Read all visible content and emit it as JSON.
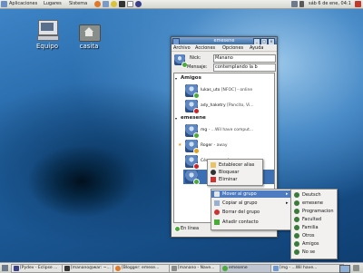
{
  "top_panel": {
    "menus": [
      "Aplicaciones",
      "Lugares",
      "Sistema"
    ],
    "clock": "sáb 6 de ene, 04:1"
  },
  "desktop": {
    "icons": [
      {
        "label": "Equipo",
        "icon": "computer-icon"
      },
      {
        "label": "casita",
        "icon": "home-folder-icon"
      }
    ]
  },
  "window": {
    "title": "emesene",
    "menu": [
      "Archivo",
      "Acciones",
      "Opciones",
      "Ayuda"
    ],
    "nick_label": "Nick:",
    "nick_value": "Manano",
    "message_label": "Mensaje:",
    "message_value": "contemplando la b",
    "groups": [
      {
        "name": "Amigos",
        "contacts": [
          {
            "name": "lukas_uto",
            "status": "[NFOC] - online",
            "dot": "#4caa3a"
          },
          {
            "name": "ady_haketry",
            "status": "[Pancito, Vi...",
            "dot": "#cc2222"
          }
        ]
      },
      {
        "name": "emesene",
        "contacts": [
          {
            "name": "mg",
            "status": "- ...Wil have comput...",
            "dot": "#4caa3a"
          },
          {
            "name": "Roger",
            "status": "- away",
            "dot": "#e0a020"
          },
          {
            "name": "César",
            "status": "- www.forumz.co...",
            "dot": "#cc2222"
          },
          {
            "name": "",
            "status": "",
            "dot": "#4caa3a"
          }
        ]
      }
    ],
    "bottom_label": "En línea"
  },
  "context_menu": {
    "items": [
      "Establecer alias",
      "Bloquear",
      "Eliminar"
    ]
  },
  "group_menu": {
    "items": [
      "Mover al grupo",
      "Copiar al grupo",
      "Borrar del grupo",
      "Añadir contacto"
    ]
  },
  "submenu": {
    "items": [
      "Deutsch",
      "emesene",
      "Programacion",
      "Facultad",
      "Familia",
      "Otros",
      "Amigos",
      "No se"
    ]
  },
  "taskbar": {
    "tasks": [
      {
        "label": "[Pydev - Eclipse ..."
      },
      {
        "label": "[manano@war: ~..."
      },
      {
        "label": "[Blogger: emese..."
      },
      {
        "label": "[manano - Nave..."
      },
      {
        "label": "emesene"
      },
      {
        "label": "[mg - ...Wil have..."
      }
    ]
  },
  "colors": {
    "selection": "#4f7cc0",
    "online": "#4caa3a",
    "busy": "#cc2222",
    "away": "#e0a020"
  }
}
